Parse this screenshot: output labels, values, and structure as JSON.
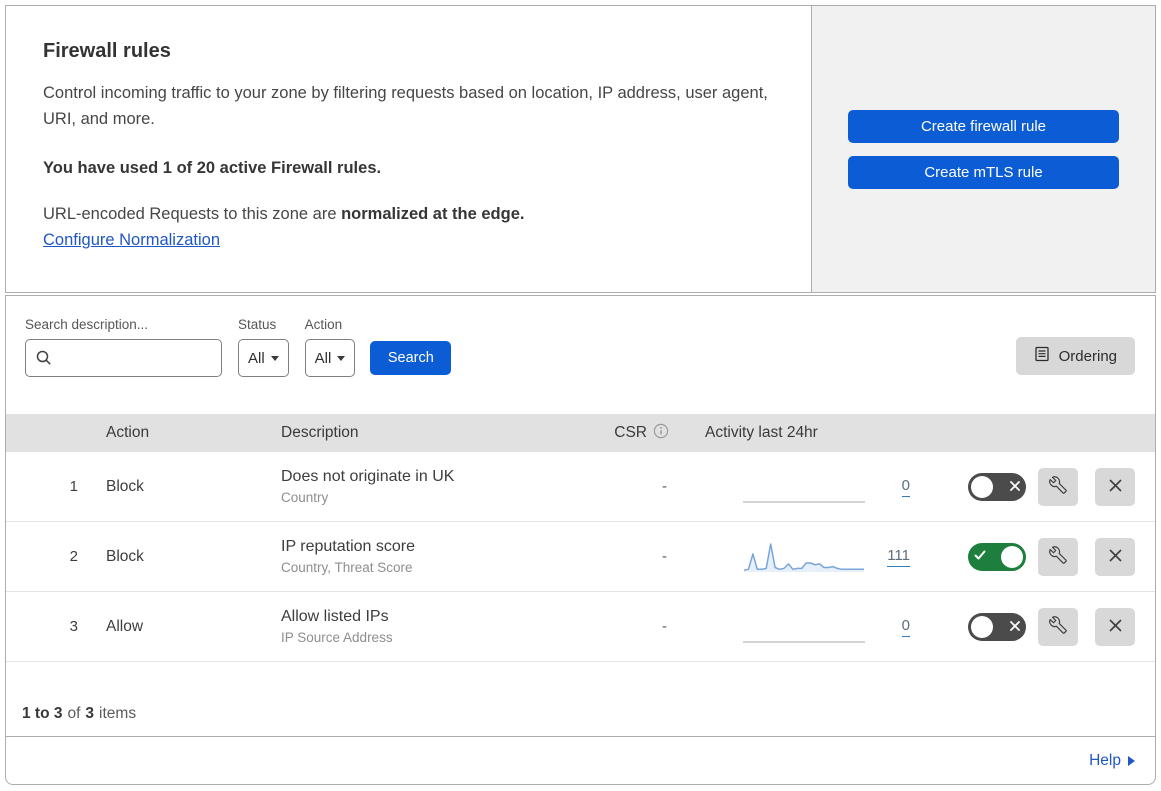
{
  "header": {
    "title": "Firewall rules",
    "description": "Control incoming traffic to your zone by filtering requests based on location, IP address, user agent, URI, and more.",
    "usage": "You have used 1 of 20 active Firewall rules.",
    "normalization_prefix": "URL-encoded Requests to this zone are ",
    "normalization_bold": "normalized at the edge.",
    "normalization_link": "Configure Normalization"
  },
  "actions_panel": {
    "create_firewall_label": "Create firewall rule",
    "create_mtls_label": "Create mTLS rule"
  },
  "filters": {
    "search_label": "Search description...",
    "status_label": "Status",
    "status_value": "All",
    "action_label": "Action",
    "action_value": "All",
    "search_button_label": "Search",
    "ordering_label": "Ordering"
  },
  "table": {
    "columns": {
      "action": "Action",
      "description": "Description",
      "csr": "CSR",
      "activity": "Activity last 24hr"
    },
    "rows": [
      {
        "num": "1",
        "action": "Block",
        "description": "Does not originate in UK",
        "criteria": "Country",
        "csr": "-",
        "activity_count": "0",
        "enabled": false,
        "sparkline": [
          0,
          0
        ]
      },
      {
        "num": "2",
        "action": "Block",
        "description": "IP reputation score",
        "criteria": "Country, Threat Score",
        "csr": "-",
        "activity_count": "111",
        "enabled": true,
        "sparkline": [
          2,
          3,
          20,
          3,
          3,
          4,
          31,
          5,
          3,
          4,
          9,
          3,
          4,
          4,
          10,
          10,
          8,
          9,
          5,
          5,
          6,
          4,
          3,
          3,
          3,
          3,
          3,
          3
        ]
      },
      {
        "num": "3",
        "action": "Allow",
        "description": "Allow listed IPs",
        "criteria": "IP Source Address",
        "csr": "-",
        "activity_count": "0",
        "enabled": false,
        "sparkline": [
          0,
          0
        ]
      }
    ],
    "footer": {
      "range": "1 to 3",
      "of_text": "of",
      "total": "3",
      "items_text": "items"
    }
  },
  "help": {
    "label": "Help"
  },
  "colors": {
    "primary_blue": "#0b5cd5",
    "link_blue": "#2157c4",
    "toggle_on_green": "#1e7e3e",
    "toggle_off_gray": "#4b4b4b",
    "header_band": "#e1e1e1",
    "panel_gray": "#f1f1f1",
    "sparkline_blue": "#79a5da"
  }
}
